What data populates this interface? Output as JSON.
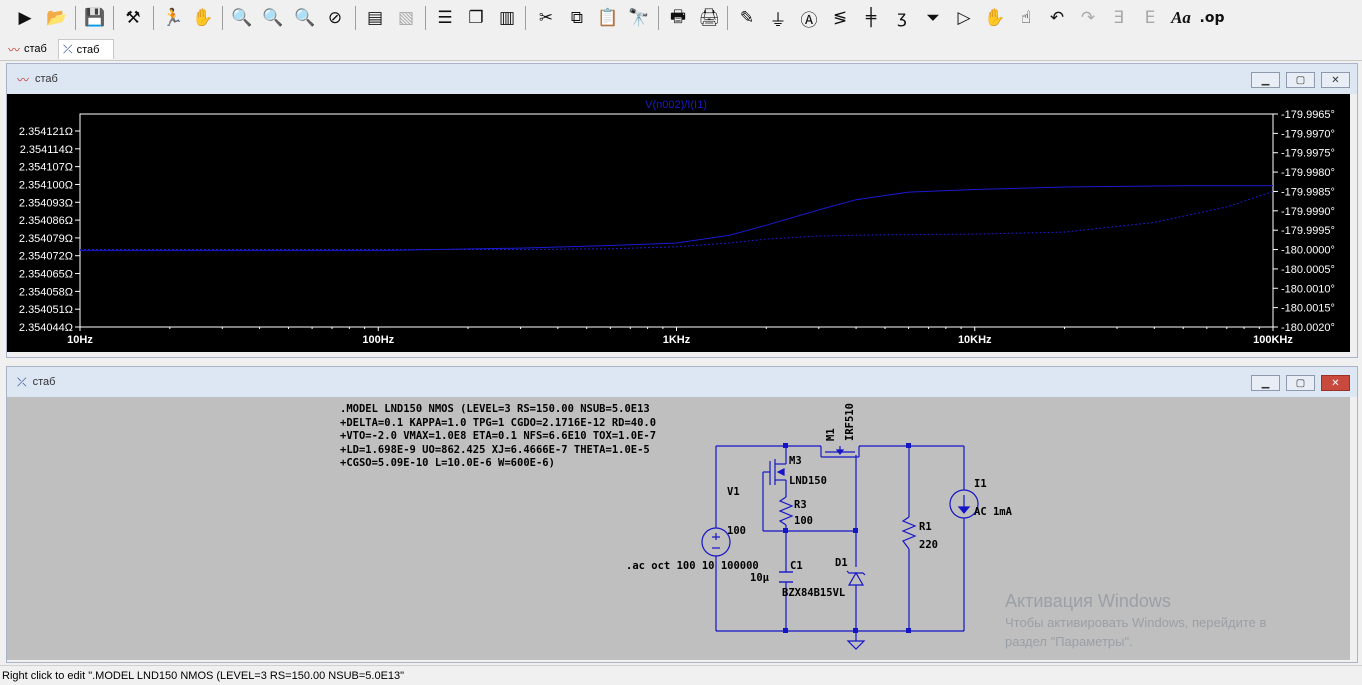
{
  "toolbar": {
    "icons": [
      "run-icon",
      "open-icon",
      "save-icon",
      "control-panel-icon",
      "halt-icon",
      "pan-hand-icon",
      "zoom-in-icon",
      "zoom-area-icon",
      "zoom-out-icon",
      "zoom-cancel-icon",
      "autorange-icon",
      "fit-icon",
      "tile-horizontal-icon",
      "cascade-icon",
      "tile-vertical-icon",
      "cut-icon",
      "copy-icon",
      "paste-icon",
      "find-icon",
      "print-setup-icon",
      "print-icon",
      "wire-pencil-icon",
      "ground-icon",
      "label-net-icon",
      "resistor-icon",
      "capacitor-icon",
      "inductor-icon",
      "diode-icon",
      "component-icon",
      "move-hand-icon",
      "drag-hand-icon",
      "undo-icon",
      "redo-icon",
      "rotate-icon",
      "mirror-icon",
      "text-icon",
      "spice-directive-icon"
    ]
  },
  "tabs": [
    {
      "label": "стаб",
      "icon": "waveform-icon"
    },
    {
      "label": "стаб",
      "icon": "schematic-icon"
    }
  ],
  "plot_window": {
    "title": "стаб",
    "trace_label": "V(n002)/I(I1)",
    "colors": {
      "background": "#000000",
      "trace": "#1a1ad0",
      "axis_text": "#ffffff"
    }
  },
  "chart_data": {
    "type": "line",
    "title": "V(n002)/I(I1)",
    "xscale": "log",
    "x_ticks": [
      "10Hz",
      "100Hz",
      "1KHz",
      "10KHz",
      "100KHz"
    ],
    "xlim": [
      10,
      100000
    ],
    "left_axis_ticks": [
      "2.354121Ω",
      "2.354114Ω",
      "2.354107Ω",
      "2.354100Ω",
      "2.354093Ω",
      "2.354086Ω",
      "2.354079Ω",
      "2.354072Ω",
      "2.354065Ω",
      "2.354058Ω",
      "2.354051Ω",
      "2.354044Ω"
    ],
    "right_axis_ticks": [
      "-179.9965°",
      "-179.9970°",
      "-179.9975°",
      "-179.9980°",
      "-179.9985°",
      "-179.9990°",
      "-179.9995°",
      "-180.0000°",
      "-180.0005°",
      "-180.0010°",
      "-180.0015°",
      "-180.0020°"
    ],
    "ylim_magnitude": [
      2.354044,
      2.354121
    ],
    "ylim_phase": [
      -180.002,
      -179.9965
    ],
    "grid": false,
    "series": [
      {
        "style": "solid",
        "axis": "left",
        "x": [
          10,
          100,
          300,
          600,
          1000,
          1500,
          2000,
          3000,
          4000,
          6000,
          10000,
          20000,
          50000,
          100000
        ],
        "y": [
          2.354074,
          2.354074,
          2.354075,
          2.354076,
          2.354077,
          2.35408,
          2.354084,
          2.35409,
          2.354094,
          2.354097,
          2.354098,
          2.354099,
          2.3540995,
          2.3540995
        ]
      },
      {
        "style": "dashed",
        "axis": "right",
        "x": [
          10,
          100,
          300,
          600,
          1000,
          1500,
          2000,
          3000,
          5000,
          10000,
          20000,
          40000,
          70000,
          100000
        ],
        "y": [
          -180.0,
          -180.0,
          -180.0,
          -179.99998,
          -179.99993,
          -179.99983,
          -179.99973,
          -179.99965,
          -179.99962,
          -179.9996,
          -179.99955,
          -179.9993,
          -179.9989,
          -179.9985
        ]
      }
    ]
  },
  "schematic_window": {
    "title": "стаб",
    "spice_directive": [
      ".MODEL LND150 NMOS (LEVEL=3 RS=150.00 NSUB=5.0E13",
      "+DELTA=0.1 KAPPA=1.0 TPG=1 CGDO=2.1716E-12 RD=40.0",
      "+VTO=-2.0 VMAX=1.0E8 ETA=0.1 NFS=6.6E10 TOX=1.0E-7",
      "+LD=1.698E-9 UO=862.425 XJ=6.4666E-7 THETA=1.0E-5",
      "+CGSO=5.09E-10 L=10.0E-6 W=600E-6)"
    ],
    "ac_directive": ".ac oct 100 10 100000",
    "components": {
      "m1_name": "M1",
      "m1_value": "IRF510",
      "m3_name": "M3",
      "m3_value": "LND150",
      "r3_name": "R3",
      "r3_value": "100",
      "v1_name": "V1",
      "v1_value": "100",
      "c1_name": "C1",
      "c1_value": "10µ",
      "d1_name": "D1",
      "d1_value": "BZX84B15VL",
      "r1_name": "R1",
      "r1_value": "220",
      "i1_name": "I1",
      "i1_value": "AC 1mA"
    },
    "colors": {
      "background": "#bfbfbf",
      "wire": "#1515c8",
      "text": "#000000"
    }
  },
  "watermark": {
    "title": "Активация Windows",
    "line1": "Чтобы активировать Windows, перейдите в",
    "line2": "раздел \"Параметры\"."
  },
  "status": {
    "text": "Right click to edit \".MODEL LND150 NMOS (LEVEL=3 RS=150.00 NSUB=5.0E13\""
  }
}
